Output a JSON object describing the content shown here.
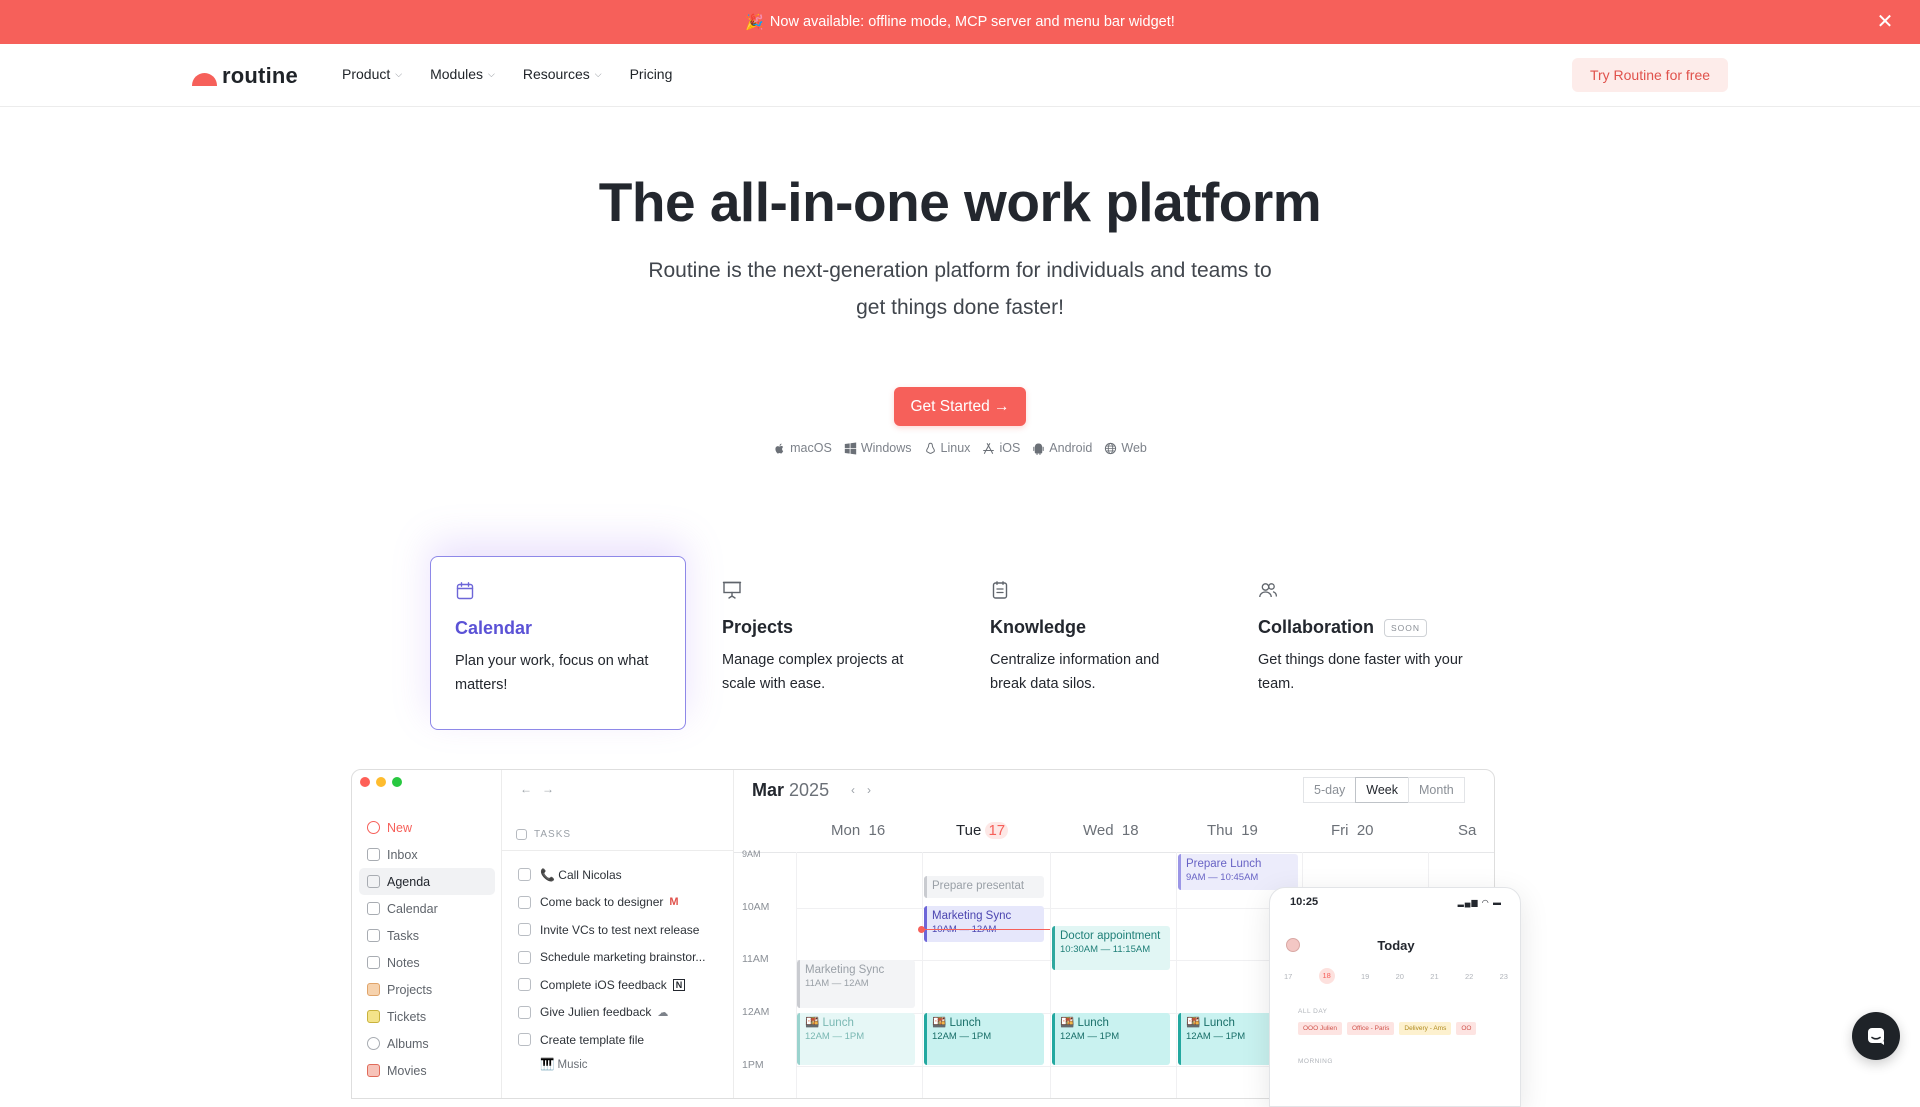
{
  "announcement": {
    "emoji": "🎉",
    "text": "Now available: offline mode, MCP server and menu bar widget!",
    "close": "✕"
  },
  "nav": {
    "brand": "routine",
    "menu": [
      {
        "label": "Product",
        "has_dropdown": true
      },
      {
        "label": "Modules",
        "has_dropdown": true
      },
      {
        "label": "Resources",
        "has_dropdown": true
      },
      {
        "label": "Pricing",
        "has_dropdown": false
      }
    ],
    "cta": "Try Routine for free"
  },
  "hero": {
    "title": "The all-in-one work platform",
    "subtitle": "Routine is the next-generation platform for individuals and teams to get things done faster!",
    "cta": "Get Started →",
    "platforms": [
      {
        "label": "macOS",
        "icon": "apple-icon"
      },
      {
        "label": "Windows",
        "icon": "windows-icon"
      },
      {
        "label": "Linux",
        "icon": "linux-icon"
      },
      {
        "label": "iOS",
        "icon": "app-store-icon"
      },
      {
        "label": "Android",
        "icon": "android-icon"
      },
      {
        "label": "Web",
        "icon": "globe-icon"
      }
    ]
  },
  "features": [
    {
      "title": "Calendar",
      "desc": "Plan your work, focus on what matters!",
      "icon": "calendar-icon",
      "active": true
    },
    {
      "title": "Projects",
      "desc": "Manage complex projects at scale with ease.",
      "icon": "presentation-board-icon",
      "active": false
    },
    {
      "title": "Knowledge",
      "desc": "Centralize information and break data silos.",
      "icon": "notepad-icon",
      "active": false
    },
    {
      "title": "Collaboration",
      "badge": "SOON",
      "desc": "Get things done faster with your team.",
      "icon": "users-icon",
      "active": false
    }
  ],
  "app": {
    "sidebar": [
      {
        "label": "New",
        "kind": "new"
      },
      {
        "label": "Inbox"
      },
      {
        "label": "Agenda",
        "active": true
      },
      {
        "label": "Calendar"
      },
      {
        "label": "Tasks"
      },
      {
        "label": "Notes"
      },
      {
        "label": "Projects"
      },
      {
        "label": "Tickets"
      },
      {
        "label": "Albums"
      },
      {
        "label": "Movies"
      }
    ],
    "tasks_header": "TASKS",
    "tasks": [
      {
        "label": "📞 Call Nicolas"
      },
      {
        "label": "Come back to designer",
        "tag": "M"
      },
      {
        "label": "Invite VCs to test next release"
      },
      {
        "label": "Schedule marketing brainstor..."
      },
      {
        "label": "Complete iOS feedback",
        "tag": "N"
      },
      {
        "label": "Give Julien feedback",
        "tag": "☁"
      },
      {
        "label": "Create template file"
      },
      {
        "label": "🎹 Music",
        "sub": true
      }
    ],
    "calendar": {
      "month": "Mar",
      "year": "2025",
      "views": [
        "5-day",
        "Week",
        "Month"
      ],
      "active_view": "Week",
      "days": [
        {
          "name": "Mon",
          "num": "16"
        },
        {
          "name": "Tue",
          "num": "17",
          "today": true
        },
        {
          "name": "Wed",
          "num": "18"
        },
        {
          "name": "Thu",
          "num": "19"
        },
        {
          "name": "Fri",
          "num": "20"
        },
        {
          "name": "Sa",
          "num": ""
        }
      ],
      "hours": [
        "9AM",
        "10AM",
        "11AM",
        "12AM",
        "1PM"
      ],
      "events": {
        "prepare_presentation": "Prepare presentat",
        "prepare_lunch": "Prepare Lunch",
        "prepare_lunch_time": "9AM — 10:45AM",
        "marketing_sync": "Marketing Sync",
        "marketing_sync_time": "10AM — 12AM",
        "marketing_sync_mon": "Marketing Sync",
        "marketing_sync_mon_time": "11AM — 12AM",
        "doctor": "Doctor appointment",
        "doctor_time": "10:30AM — 11:15AM",
        "lunch": "🍱 Lunch",
        "lunch_plain": "Lunch",
        "lunch_time": "12AM — 1PM"
      }
    }
  },
  "phone": {
    "time": "10:25",
    "title": "Today",
    "week": [
      "17",
      "18",
      "19",
      "20",
      "21",
      "22",
      "23"
    ],
    "today_index": 1,
    "allday_label": "ALL DAY",
    "chips": [
      {
        "label": "OOO Julien",
        "bg": "#fde4e2",
        "fg": "#d0534c"
      },
      {
        "label": "Office - Paris",
        "bg": "#fde4e2",
        "fg": "#d0534c"
      },
      {
        "label": "Delivery - Ams",
        "bg": "#fdf1cf",
        "fg": "#b08a1e"
      },
      {
        "label": "OO",
        "bg": "#fde4e2",
        "fg": "#d0534c"
      }
    ],
    "morning_label": "MORNING"
  },
  "colors": {
    "brand": "#f6605a",
    "accent": "#5b52d6"
  }
}
